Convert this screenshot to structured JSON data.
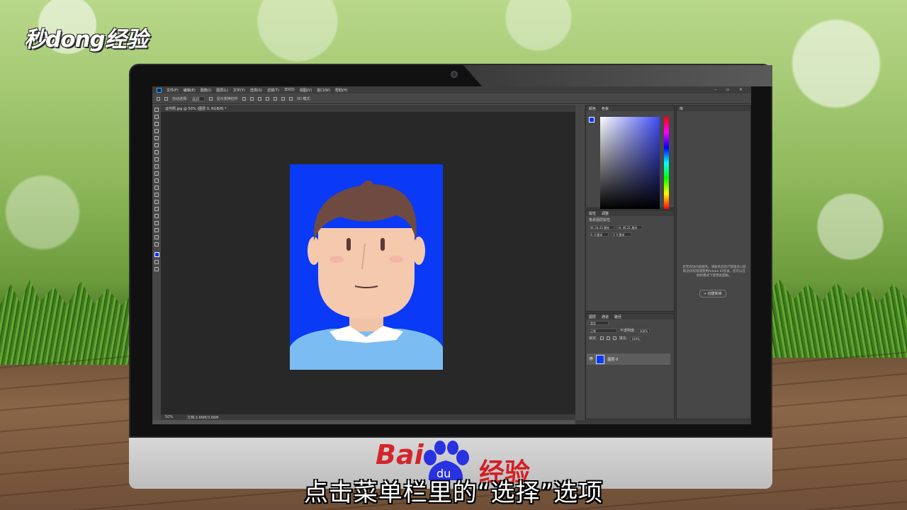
{
  "watermark": {
    "brand": "秒dong经验"
  },
  "photoshop": {
    "menu": [
      "文件(F)",
      "编辑(E)",
      "图像(I)",
      "图层(L)",
      "文字(Y)",
      "选择(S)",
      "滤镜(T)",
      "3D(D)",
      "视图(V)",
      "窗口(W)",
      "帮助(H)"
    ],
    "window_controls": "– ▫ ×",
    "options": {
      "auto_select_label": "自动选择:",
      "auto_select_value": "图层",
      "transform_label": "显示变换控件",
      "mode_3d": "3D 模式:"
    },
    "document_tab": "证件照.jpg @ 50% (图层 0, RGB/8) *",
    "status": {
      "zoom": "50%",
      "doc_size": "文档:3.66M/3.66M"
    },
    "color_panel": {
      "tabs": [
        "颜色",
        "色板"
      ]
    },
    "properties_panel": {
      "tabs": [
        "属性",
        "调整"
      ],
      "title": "像素图层属性",
      "w": "W: 24.43 厘米",
      "h": "H: 46.21 厘米",
      "x": "X: 0 厘米",
      "y": "Y: 0 厘米"
    },
    "library_panel": {
      "tab": "库",
      "message": "您无权访问此服务。请联系您的IT管理员以获取访问权限或使用Adobe ID登录。您可以在脱机模式下使用此面板。",
      "create_button": "+ 创建新库"
    },
    "layers_panel": {
      "tabs": [
        "图层",
        "通道",
        "路径"
      ],
      "filter": "类型",
      "blend_mode": "正常",
      "opacity_label": "不透明度:",
      "opacity_value": "100%",
      "lock_label": "锁定:",
      "fill_label": "填充:",
      "fill_value": "100%",
      "layer_name": "图层 0"
    },
    "colors": {
      "foreground": "#0033ff",
      "canvas_bg": "#0a3af5"
    }
  },
  "baidu_logo": {
    "left": "Bai",
    "paw_text": "du",
    "right": "经验"
  },
  "subtitle": "点击菜单栏里的“选择”选项"
}
